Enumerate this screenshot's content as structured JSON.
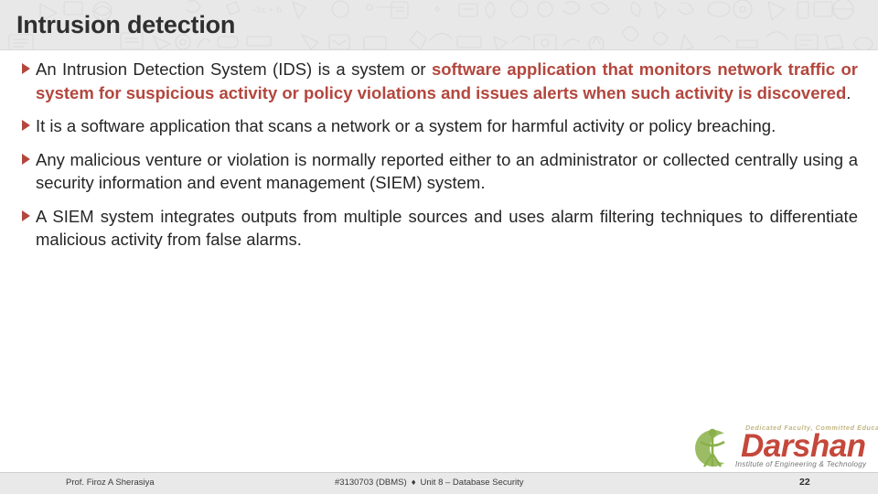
{
  "header": {
    "title": "Intrusion detection",
    "background_color": "#e8e8e8",
    "doodle_icon_names": [
      "document-icon",
      "envelope-icon",
      "globe-icon",
      "cloud-icon",
      "lock-icon",
      "camera-icon",
      "lightbulb-icon",
      "pencil-icon",
      "monitor-icon",
      "tablet-icon",
      "clipboard-icon",
      "book-icon",
      "compass-icon",
      "location-pin-icon",
      "cd-icon",
      "ruler-icon",
      "graduation-cap-icon",
      "paper-clip-icon",
      "chat-icon",
      "bell-icon"
    ]
  },
  "accent_colors": {
    "highlight_red": "#b3473e",
    "body_text": "#262626",
    "logo_red": "#c0392b",
    "logo_green": "#8ab04a",
    "footer_background": "#e9e9e9"
  },
  "content": {
    "bullets": [
      {
        "marker": "triangle-bullet-icon",
        "plain_lead": "An Intrusion Detection System (IDS) is a system or ",
        "highlight": "software application that monitors network traffic or system for suspicious activity or policy violations and issues alerts when such activity is discovered",
        "plain_tail": "."
      },
      {
        "marker": "triangle-bullet-icon",
        "plain_lead": "It is a software application that scans a network or a system for harmful activity or policy breaching.",
        "highlight": "",
        "plain_tail": ""
      },
      {
        "marker": "triangle-bullet-icon",
        "plain_lead": "Any malicious venture or violation is normally reported either to an administrator or collected centrally using a security information and event management (SIEM) system.",
        "highlight": "",
        "plain_tail": ""
      },
      {
        "marker": "triangle-bullet-icon",
        "plain_lead": "A SIEM system integrates outputs from multiple sources and uses alarm filtering techniques to differentiate malicious activity from false alarms.",
        "highlight": "",
        "plain_tail": ""
      }
    ]
  },
  "logo": {
    "wordmark": "Darshan",
    "tagline_top": "Dedicated Faculty, Committed Education",
    "tagline_bottom": "Institute of Engineering & Technology",
    "mark_icon": "darshan-swirl-figure-icon"
  },
  "footer": {
    "presenter": "Prof. Firoz A Sherasiya",
    "course_code": "#3130703 (DBMS)",
    "separator": "♦",
    "unit": "Unit 8 – Database Security",
    "page_number": "22"
  }
}
